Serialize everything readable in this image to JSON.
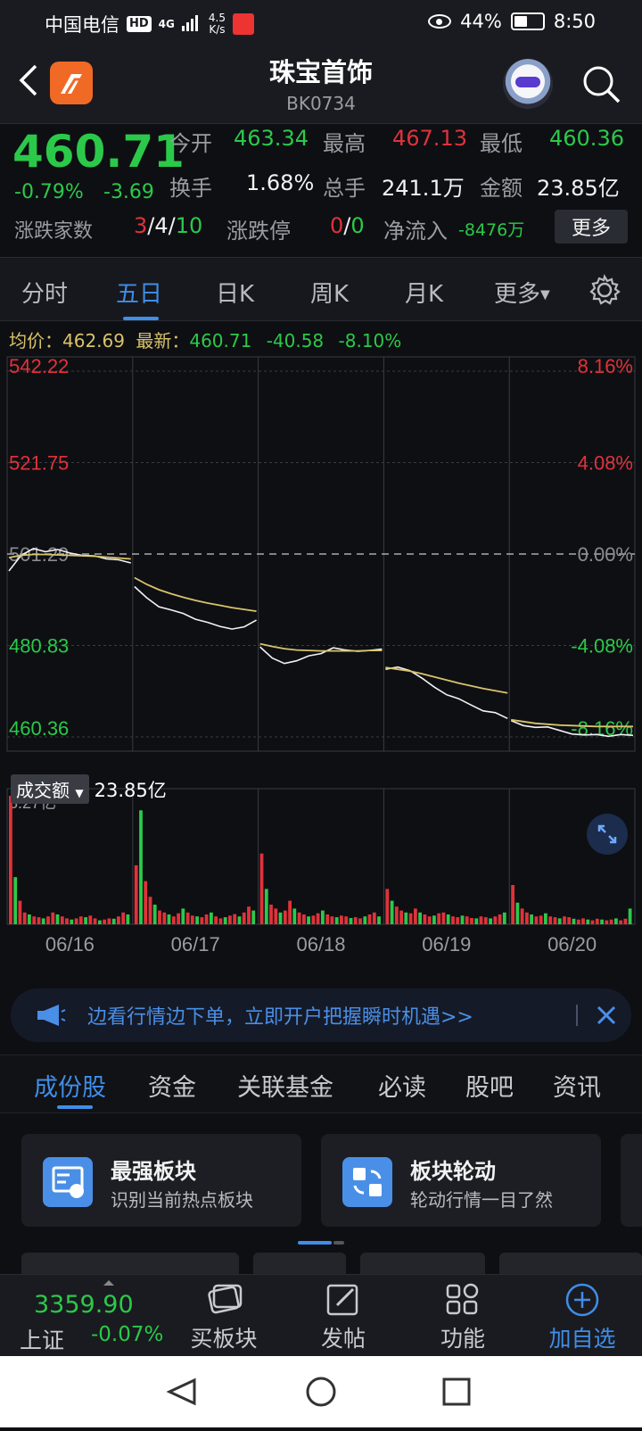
{
  "status_bar": {
    "carrier": "中国电信",
    "hd": "HD",
    "net_type": "4G",
    "net_speed_value": "4.5",
    "net_speed_unit": "K/s",
    "battery": "44%",
    "time": "8:50"
  },
  "header": {
    "title": "珠宝首饰",
    "code": "BK0734"
  },
  "quote": {
    "price": "460.71",
    "change_pct": "-0.79%",
    "change": "-3.69",
    "open_label": "今开",
    "open": "463.34",
    "high_label": "最高",
    "high": "467.13",
    "low_label": "最低",
    "low": "460.36",
    "turnover_rate_label": "换手",
    "turnover_rate": "1.68%",
    "volume_label": "总手",
    "volume": "241.1万",
    "amount_label": "金额",
    "amount": "23.85亿",
    "breadth_label": "涨跌家数",
    "breadth_up": "3",
    "breadth_flat": "4",
    "breadth_down": "10",
    "limit_label": "涨跌停",
    "limit_up": "0",
    "limit_down": "0",
    "net_inflow_label": "净流入",
    "net_inflow": "-8476万",
    "more_label": "更多",
    "slash": "/"
  },
  "period_tabs": {
    "intraday": "分时",
    "five_day": "五日",
    "daily": "日K",
    "weekly": "周K",
    "monthly": "月K",
    "more": "更多"
  },
  "info_line": {
    "avg_label": "均价：",
    "avg": "462.69",
    "latest_label": "最新：",
    "latest": "460.71",
    "change": "-40.58",
    "change_pct": "-8.10%"
  },
  "chart_data": {
    "type": "line",
    "title": "",
    "y_axis_left": [
      "542.22",
      "521.75",
      "501.29",
      "480.83",
      "460.36"
    ],
    "y_axis_right": [
      "8.16%",
      "4.08%",
      "0.00%",
      "-4.08%",
      "-8.16%"
    ],
    "ylim": [
      460.36,
      542.22
    ],
    "reference_price": 501.29,
    "days": [
      "06/16",
      "06/17",
      "06/18",
      "06/19",
      "06/20"
    ],
    "series": [
      {
        "kind": "price",
        "values": [
          [
            497.5,
            501.0,
            502.5,
            501.8,
            502.3,
            501.5,
            501.0,
            500.9,
            500.2,
            500.0,
            499.3
          ],
          [
            494.0,
            491.5,
            489.5,
            488.8,
            488.0,
            486.7,
            486.0,
            485.1,
            484.5,
            485.0,
            486.5
          ],
          [
            480.5,
            478.0,
            476.8,
            477.4,
            478.5,
            479.0,
            480.3,
            479.8,
            479.5,
            479.7,
            480.0
          ],
          [
            475.5,
            476.0,
            475.2,
            473.5,
            471.5,
            469.8,
            468.9,
            467.5,
            466.2,
            465.8,
            464.5
          ],
          [
            464.0,
            462.9,
            462.5,
            462.6,
            461.8,
            461.0,
            460.8,
            460.9,
            460.5,
            460.9,
            460.7
          ]
        ]
      },
      {
        "kind": "average",
        "values": [
          [
            500.5,
            501.0,
            501.2,
            501.2,
            501.1,
            501.0,
            500.9,
            500.8,
            500.6,
            500.4,
            500.2
          ],
          [
            496.0,
            494.5,
            493.3,
            492.4,
            491.6,
            490.9,
            490.3,
            489.8,
            489.3,
            488.9,
            488.5
          ],
          [
            481.2,
            480.6,
            480.1,
            479.8,
            479.7,
            479.6,
            479.6,
            479.6,
            479.6,
            479.7,
            479.7
          ],
          [
            475.9,
            475.5,
            475.1,
            474.5,
            473.8,
            473.1,
            472.4,
            471.8,
            471.2,
            470.7,
            470.2
          ],
          [
            464.2,
            463.8,
            463.4,
            463.2,
            463.0,
            462.9,
            462.8,
            462.7,
            462.7,
            462.7,
            462.7
          ]
        ]
      }
    ],
    "grid": true
  },
  "volume_chart": {
    "label": "成交额",
    "total": "23.85亿",
    "max_label": "3.27亿",
    "max_value": 3.27,
    "bars": [
      [
        3.27,
        1.2,
        0.6,
        0.3,
        0.25,
        0.2,
        0.18,
        0.15,
        0.2,
        0.3,
        0.25,
        0.2,
        0.15,
        0.12,
        0.15,
        0.2,
        0.18,
        0.22,
        0.15,
        0.1,
        0.12,
        0.15,
        0.14,
        0.2,
        0.3,
        0.25
      ],
      [
        1.5,
        2.9,
        1.1,
        0.7,
        0.5,
        0.35,
        0.3,
        0.25,
        0.2,
        0.28,
        0.4,
        0.3,
        0.22,
        0.2,
        0.18,
        0.25,
        0.3,
        0.2,
        0.15,
        0.18,
        0.22,
        0.26,
        0.2,
        0.3,
        0.45,
        0.35
      ],
      [
        1.8,
        0.9,
        0.5,
        0.4,
        0.3,
        0.35,
        0.6,
        0.4,
        0.3,
        0.25,
        0.2,
        0.22,
        0.28,
        0.35,
        0.25,
        0.2,
        0.18,
        0.22,
        0.2,
        0.16,
        0.18,
        0.15,
        0.2,
        0.25,
        0.3,
        0.2
      ],
      [
        0.9,
        0.6,
        0.45,
        0.35,
        0.3,
        0.28,
        0.4,
        0.3,
        0.25,
        0.2,
        0.22,
        0.28,
        0.3,
        0.25,
        0.2,
        0.18,
        0.22,
        0.2,
        0.16,
        0.15,
        0.2,
        0.18,
        0.15,
        0.2,
        0.25,
        0.3
      ],
      [
        1.0,
        0.55,
        0.4,
        0.3,
        0.25,
        0.2,
        0.22,
        0.28,
        0.2,
        0.18,
        0.15,
        0.2,
        0.18,
        0.14,
        0.12,
        0.15,
        0.12,
        0.1,
        0.14,
        0.12,
        0.1,
        0.12,
        0.15,
        0.1,
        0.14,
        0.4
      ]
    ],
    "up_color": "#e0323a",
    "down_color": "#2bc94a"
  },
  "promo": {
    "text": "边看行情边下单，立即开户把握瞬时机遇>>"
  },
  "content_tabs": [
    "成份股",
    "资金",
    "关联基金",
    "必读",
    "股吧",
    "资讯"
  ],
  "cards": [
    {
      "title": "最强板块",
      "subtitle": "识别当前热点板块"
    },
    {
      "title": "板块轮动",
      "subtitle": "轮动行情一目了然"
    }
  ],
  "bottom_nav": {
    "index_price": "3359.90",
    "index_name": "上证",
    "index_change": "-0.07%",
    "buy_sector": "买板块",
    "post": "发帖",
    "functions": "功能",
    "add_watch": "加自选"
  },
  "colors": {
    "up": "#e0323a",
    "down": "#2bc94a",
    "accent": "#3f8ee8",
    "avg_line": "#d9c36a"
  }
}
